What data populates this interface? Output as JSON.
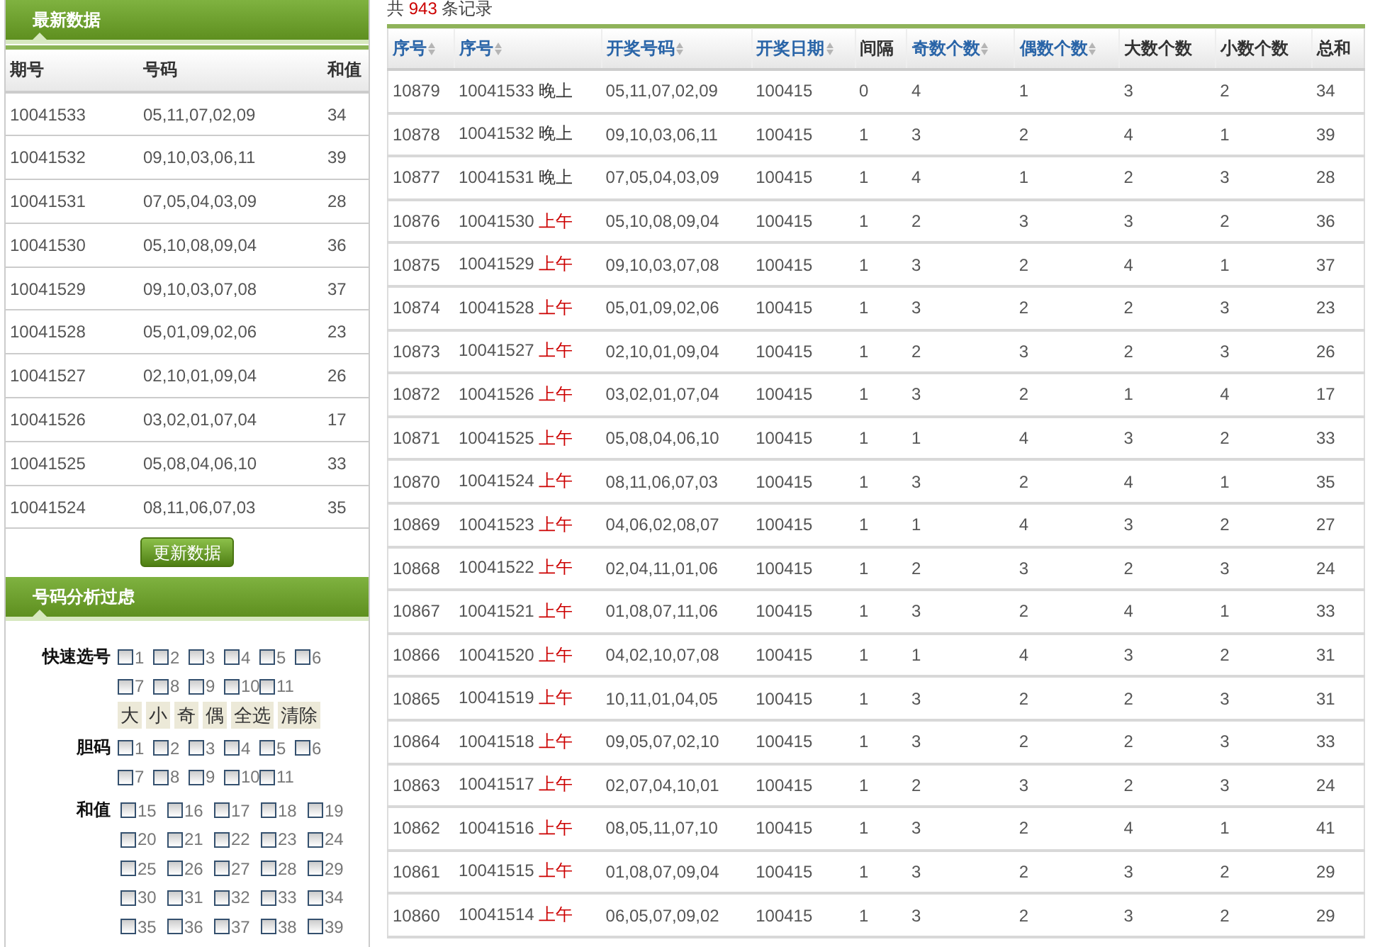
{
  "latest": {
    "title": "最新数据",
    "columns": [
      "期号",
      "号码",
      "和值"
    ],
    "rows": [
      [
        "10041533",
        "05,11,07,02,09",
        "34"
      ],
      [
        "10041532",
        "09,10,03,06,11",
        "39"
      ],
      [
        "10041531",
        "07,05,04,03,09",
        "28"
      ],
      [
        "10041530",
        "05,10,08,09,04",
        "36"
      ],
      [
        "10041529",
        "09,10,03,07,08",
        "37"
      ],
      [
        "10041528",
        "05,01,09,02,06",
        "23"
      ],
      [
        "10041527",
        "02,10,01,09,04",
        "26"
      ],
      [
        "10041526",
        "03,02,01,07,04",
        "17"
      ],
      [
        "10041525",
        "05,08,04,06,10",
        "33"
      ],
      [
        "10041524",
        "08,11,06,07,03",
        "35"
      ]
    ],
    "button": "更新数据"
  },
  "filter": {
    "title": "号码分析过虑",
    "groups": [
      {
        "label": "快速选号",
        "options": [
          {
            "label": "1",
            "checked": false
          },
          {
            "label": "2",
            "checked": false
          },
          {
            "label": "3",
            "checked": false
          },
          {
            "label": "4",
            "checked": false
          },
          {
            "label": "5",
            "checked": false
          },
          {
            "label": "6",
            "checked": false
          },
          {
            "label": "7",
            "checked": false
          },
          {
            "label": "8",
            "checked": false
          },
          {
            "label": "9",
            "checked": false
          },
          {
            "label": "10",
            "checked": false
          },
          {
            "label": "11",
            "checked": false
          }
        ],
        "buttons": [
          "大",
          "小",
          "奇",
          "偶",
          "全选",
          "清除"
        ]
      },
      {
        "label": "胆码",
        "options": [
          {
            "label": "1",
            "checked": false
          },
          {
            "label": "2",
            "checked": false
          },
          {
            "label": "3",
            "checked": false
          },
          {
            "label": "4",
            "checked": false
          },
          {
            "label": "5",
            "checked": false
          },
          {
            "label": "6",
            "checked": false
          },
          {
            "label": "7",
            "checked": false
          },
          {
            "label": "8",
            "checked": false
          },
          {
            "label": "9",
            "checked": false
          },
          {
            "label": "10",
            "checked": false
          },
          {
            "label": "11",
            "checked": false
          }
        ]
      },
      {
        "label": "和值",
        "options": [
          {
            "label": "15",
            "checked": false
          },
          {
            "label": "16",
            "checked": false
          },
          {
            "label": "17",
            "checked": false
          },
          {
            "label": "18",
            "checked": false
          },
          {
            "label": "19",
            "checked": false
          },
          {
            "label": "20",
            "checked": false
          },
          {
            "label": "21",
            "checked": false
          },
          {
            "label": "22",
            "checked": false
          },
          {
            "label": "23",
            "checked": false
          },
          {
            "label": "24",
            "checked": false
          },
          {
            "label": "25",
            "checked": false
          },
          {
            "label": "26",
            "checked": false
          },
          {
            "label": "27",
            "checked": false
          },
          {
            "label": "28",
            "checked": false
          },
          {
            "label": "29",
            "checked": false
          },
          {
            "label": "30",
            "checked": false
          },
          {
            "label": "31",
            "checked": false
          },
          {
            "label": "32",
            "checked": false
          },
          {
            "label": "33",
            "checked": false
          },
          {
            "label": "34",
            "checked": false
          },
          {
            "label": "35",
            "checked": false
          },
          {
            "label": "36",
            "checked": false
          },
          {
            "label": "37",
            "checked": false
          },
          {
            "label": "38",
            "checked": false
          },
          {
            "label": "39",
            "checked": false
          }
        ]
      }
    ]
  },
  "records": {
    "prefix": "共",
    "count": "943",
    "suffix": "条记录",
    "columns": [
      {
        "label": "序号",
        "sortable": true
      },
      {
        "label": "序号",
        "sortable": true
      },
      {
        "label": "开奖号码",
        "sortable": true
      },
      {
        "label": "开奖日期",
        "sortable": true
      },
      {
        "label": "间隔",
        "sortable": false
      },
      {
        "label": "奇数个数",
        "sortable": true
      },
      {
        "label": "偶数个数",
        "sortable": true
      },
      {
        "label": "大数个数",
        "sortable": false
      },
      {
        "label": "小数个数",
        "sortable": false
      },
      {
        "label": "总和",
        "sortable": false
      }
    ],
    "rows": [
      {
        "no": "10879",
        "issue": "10041533",
        "period": "晚上",
        "color": "#333333",
        "numbers": "05,11,07,02,09",
        "date": "100415",
        "gap": "0",
        "odd": "4",
        "even": "1",
        "big": "3",
        "small": "2",
        "sum": "34"
      },
      {
        "no": "10878",
        "issue": "10041532",
        "period": "晚上",
        "color": "#333333",
        "numbers": "09,10,03,06,11",
        "date": "100415",
        "gap": "1",
        "odd": "3",
        "even": "2",
        "big": "4",
        "small": "1",
        "sum": "39"
      },
      {
        "no": "10877",
        "issue": "10041531",
        "period": "晚上",
        "color": "#333333",
        "numbers": "07,05,04,03,09",
        "date": "100415",
        "gap": "1",
        "odd": "4",
        "even": "1",
        "big": "2",
        "small": "3",
        "sum": "28"
      },
      {
        "no": "10876",
        "issue": "10041530",
        "period": "上午",
        "color": "#cc0000",
        "numbers": "05,10,08,09,04",
        "date": "100415",
        "gap": "1",
        "odd": "2",
        "even": "3",
        "big": "3",
        "small": "2",
        "sum": "36"
      },
      {
        "no": "10875",
        "issue": "10041529",
        "period": "上午",
        "color": "#cc0000",
        "numbers": "09,10,03,07,08",
        "date": "100415",
        "gap": "1",
        "odd": "3",
        "even": "2",
        "big": "4",
        "small": "1",
        "sum": "37"
      },
      {
        "no": "10874",
        "issue": "10041528",
        "period": "上午",
        "color": "#cc0000",
        "numbers": "05,01,09,02,06",
        "date": "100415",
        "gap": "1",
        "odd": "3",
        "even": "2",
        "big": "2",
        "small": "3",
        "sum": "23"
      },
      {
        "no": "10873",
        "issue": "10041527",
        "period": "上午",
        "color": "#cc0000",
        "numbers": "02,10,01,09,04",
        "date": "100415",
        "gap": "1",
        "odd": "2",
        "even": "3",
        "big": "2",
        "small": "3",
        "sum": "26"
      },
      {
        "no": "10872",
        "issue": "10041526",
        "period": "上午",
        "color": "#cc0000",
        "numbers": "03,02,01,07,04",
        "date": "100415",
        "gap": "1",
        "odd": "3",
        "even": "2",
        "big": "1",
        "small": "4",
        "sum": "17"
      },
      {
        "no": "10871",
        "issue": "10041525",
        "period": "上午",
        "color": "#cc0000",
        "numbers": "05,08,04,06,10",
        "date": "100415",
        "gap": "1",
        "odd": "1",
        "even": "4",
        "big": "3",
        "small": "2",
        "sum": "33"
      },
      {
        "no": "10870",
        "issue": "10041524",
        "period": "上午",
        "color": "#cc0000",
        "numbers": "08,11,06,07,03",
        "date": "100415",
        "gap": "1",
        "odd": "3",
        "even": "2",
        "big": "4",
        "small": "1",
        "sum": "35"
      },
      {
        "no": "10869",
        "issue": "10041523",
        "period": "上午",
        "color": "#cc0000",
        "numbers": "04,06,02,08,07",
        "date": "100415",
        "gap": "1",
        "odd": "1",
        "even": "4",
        "big": "3",
        "small": "2",
        "sum": "27"
      },
      {
        "no": "10868",
        "issue": "10041522",
        "period": "上午",
        "color": "#cc0000",
        "numbers": "02,04,11,01,06",
        "date": "100415",
        "gap": "1",
        "odd": "2",
        "even": "3",
        "big": "2",
        "small": "3",
        "sum": "24"
      },
      {
        "no": "10867",
        "issue": "10041521",
        "period": "上午",
        "color": "#cc0000",
        "numbers": "01,08,07,11,06",
        "date": "100415",
        "gap": "1",
        "odd": "3",
        "even": "2",
        "big": "4",
        "small": "1",
        "sum": "33"
      },
      {
        "no": "10866",
        "issue": "10041520",
        "period": "上午",
        "color": "#cc0000",
        "numbers": "04,02,10,07,08",
        "date": "100415",
        "gap": "1",
        "odd": "1",
        "even": "4",
        "big": "3",
        "small": "2",
        "sum": "31"
      },
      {
        "no": "10865",
        "issue": "10041519",
        "period": "上午",
        "color": "#cc0000",
        "numbers": "10,11,01,04,05",
        "date": "100415",
        "gap": "1",
        "odd": "3",
        "even": "2",
        "big": "2",
        "small": "3",
        "sum": "31"
      },
      {
        "no": "10864",
        "issue": "10041518",
        "period": "上午",
        "color": "#cc0000",
        "numbers": "09,05,07,02,10",
        "date": "100415",
        "gap": "1",
        "odd": "3",
        "even": "2",
        "big": "2",
        "small": "3",
        "sum": "33"
      },
      {
        "no": "10863",
        "issue": "10041517",
        "period": "上午",
        "color": "#cc0000",
        "numbers": "02,07,04,10,01",
        "date": "100415",
        "gap": "1",
        "odd": "2",
        "even": "3",
        "big": "2",
        "small": "3",
        "sum": "24"
      },
      {
        "no": "10862",
        "issue": "10041516",
        "period": "上午",
        "color": "#cc0000",
        "numbers": "08,05,11,07,10",
        "date": "100415",
        "gap": "1",
        "odd": "3",
        "even": "2",
        "big": "4",
        "small": "1",
        "sum": "41"
      },
      {
        "no": "10861",
        "issue": "10041515",
        "period": "上午",
        "color": "#cc0000",
        "numbers": "01,08,07,09,04",
        "date": "100415",
        "gap": "1",
        "odd": "3",
        "even": "2",
        "big": "3",
        "small": "2",
        "sum": "29"
      },
      {
        "no": "10860",
        "issue": "10041514",
        "period": "上午",
        "color": "#cc0000",
        "numbers": "06,05,07,09,02",
        "date": "100415",
        "gap": "1",
        "odd": "3",
        "even": "2",
        "big": "3",
        "small": "2",
        "sum": "29"
      }
    ]
  }
}
